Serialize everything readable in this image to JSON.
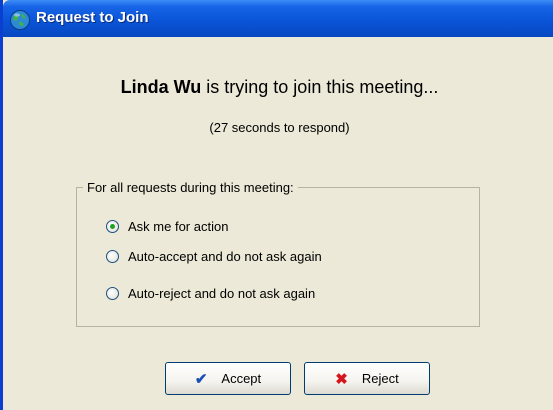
{
  "window": {
    "title": "Request to Join"
  },
  "message": {
    "requester_name": "Linda Wu",
    "text": " is trying to join this meeting..."
  },
  "countdown": "(27 seconds to respond)",
  "options_group": {
    "label": "For all requests during this meeting:",
    "options": [
      {
        "label": "Ask me for action",
        "checked": true
      },
      {
        "label": "Auto-accept and do not ask again",
        "checked": false
      },
      {
        "label": "Auto-reject and do not ask again",
        "checked": false
      }
    ]
  },
  "buttons": {
    "accept_label": "Accept",
    "reject_label": "Reject"
  },
  "icons": {
    "title": "globe-icon",
    "accept": "checkmark-icon",
    "reject": "x-icon"
  },
  "colors": {
    "titlebar": "#0a54d8",
    "dialog_bg": "#ece9d8",
    "radio_selected": "#21a121",
    "accept_icon": "#1a4fb5",
    "reject_icon": "#d4161c"
  }
}
